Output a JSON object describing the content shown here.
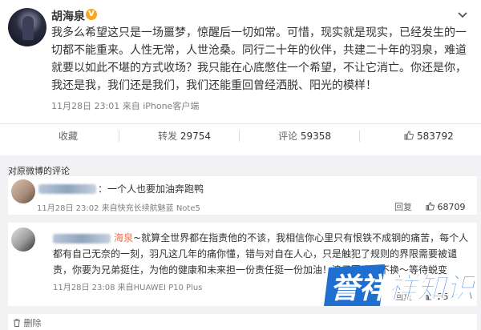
{
  "post": {
    "author": "胡海泉",
    "badge": "V",
    "text": "我多么希望这只是一场噩梦，惊醒后一切如常。可惜，现实就是现实，已经发生的一切都不能重来。人性无常，人世沧桑。同行二十年的伙伴，共建二十年的羽泉，难道就要以如此不堪的方式收场？我只能在心底憋住一个希望，不让它消亡。你还是你，我还是我，我们还是我们，我们还能重回曾经洒脱、阳光的模样！",
    "time": "11月28日 23:01",
    "source": "来自 iPhone客户端"
  },
  "actions": {
    "favorite": "收藏",
    "repost_label": "转发",
    "repost_count": "29754",
    "comment_label": "评论",
    "comment_count": "59358",
    "like_count": "583792"
  },
  "comments_section": {
    "title": "对原微博的评论"
  },
  "comments": [
    {
      "text": "：一个人也要加油奔跑鸭",
      "time": "11月28日 23:02",
      "source": "来自快充长续航魅蓝 Note5",
      "reply_label": "回复",
      "likes": "68709"
    },
    {
      "mention": "海泉",
      "text": "~就算全世界都在指责他的不该，我相信你心里只有恨铁不成钢的痛苦，每个人都有自己无奈的一刻，羽凡这几年的痛你懂，错与对自在人心，只是触犯了规则的界限需要被谴责，你要为兄弟挺住，为他的健康和未来担一份责任挺一份加油！浪子回头金不换～等待蜕变",
      "time": "11月28日 23:08",
      "source": "来自HUAWEI P10 Plus",
      "reply_label": "回复",
      "likes": "25"
    }
  ],
  "footer": {
    "label": "删除"
  },
  "watermark": {
    "part1": "誉祥",
    "part2": "祥知识",
    "color1": "#1f6fd1",
    "color2": "#ffffff"
  },
  "colors": {
    "link": "#eb7350",
    "badge": "#f5a623",
    "muted": "#808080"
  }
}
